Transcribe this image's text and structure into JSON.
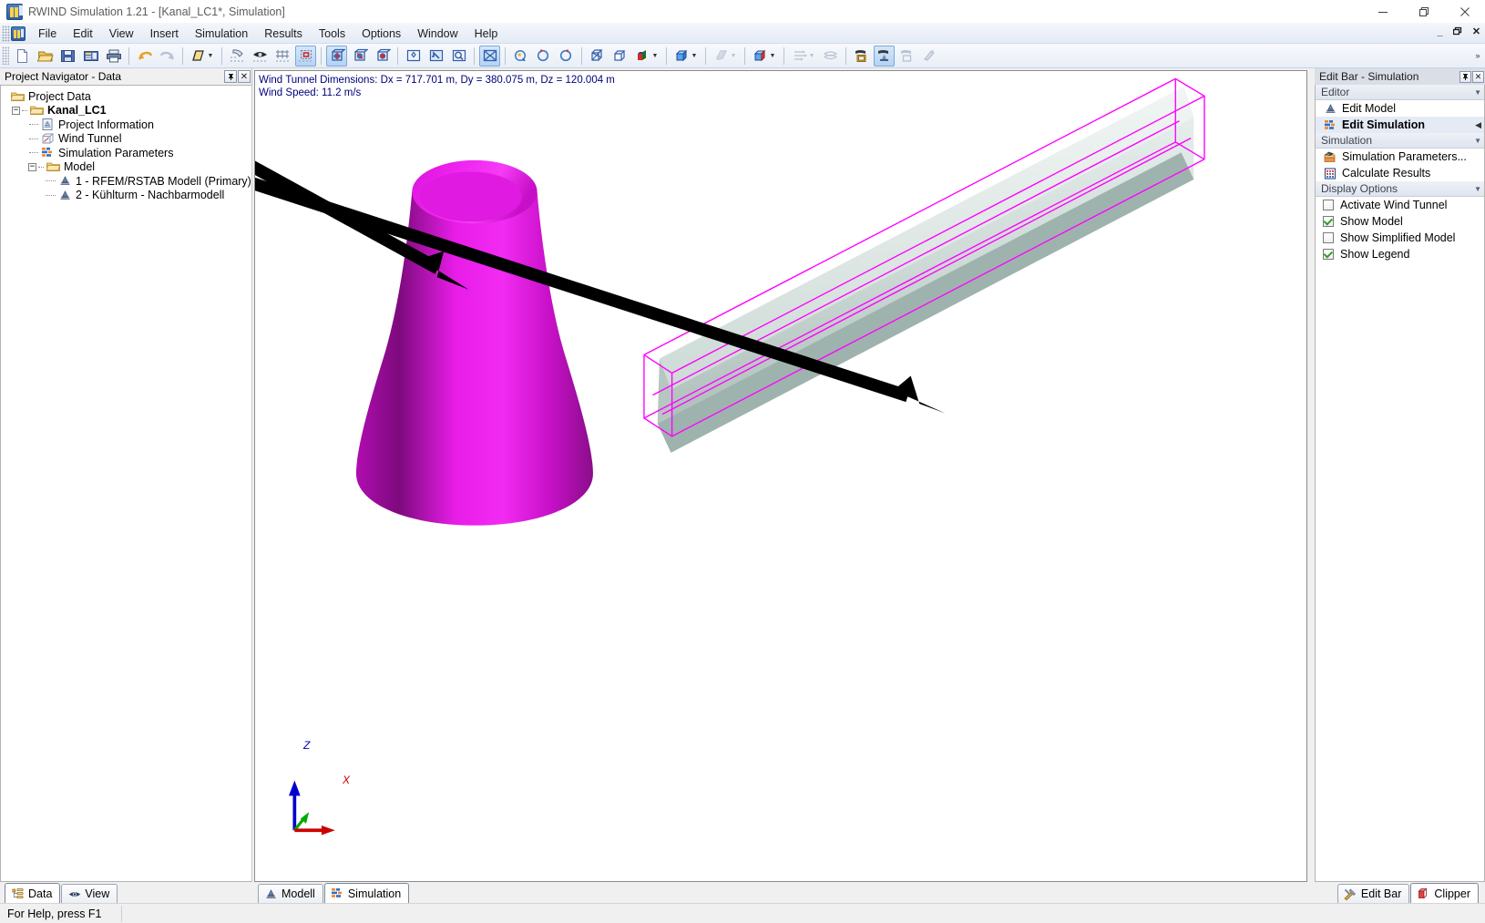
{
  "window": {
    "title": "RWIND Simulation 1.21 - [Kanal_LC1*, Simulation]",
    "app_icon": "rwind-icon",
    "controls": {
      "minimize": "minimize-icon",
      "restore": "restore-icon",
      "close": "close-icon"
    }
  },
  "mdi_controls": {
    "minimize": "_",
    "restore": "□",
    "close": "✕"
  },
  "menu": {
    "items": [
      {
        "label": "File"
      },
      {
        "label": "Edit"
      },
      {
        "label": "View"
      },
      {
        "label": "Insert"
      },
      {
        "label": "Simulation"
      },
      {
        "label": "Results"
      },
      {
        "label": "Tools"
      },
      {
        "label": "Options"
      },
      {
        "label": "Window"
      },
      {
        "label": "Help"
      }
    ]
  },
  "toolbar": {
    "groups": [
      {
        "buttons": [
          {
            "name": "new-file-button",
            "icon": "new-document-icon"
          },
          {
            "name": "open-file-button",
            "icon": "open-folder-icon"
          },
          {
            "name": "save-button",
            "icon": "floppy-disk-icon"
          },
          {
            "name": "print-preview-button",
            "icon": "print-preview-icon"
          },
          {
            "name": "print-button",
            "icon": "printer-icon"
          }
        ]
      },
      {
        "buttons": [
          {
            "name": "undo-button",
            "icon": "undo-arrow-icon"
          },
          {
            "name": "redo-button",
            "icon": "redo-arrow-icon"
          }
        ]
      },
      {
        "buttons": [
          {
            "name": "render-mode-button",
            "icon": "render-mode-icon",
            "has_dropdown": true
          }
        ]
      },
      {
        "buttons": [
          {
            "name": "snap-button",
            "icon": "snap-grid-icon"
          },
          {
            "name": "object-snap-button",
            "icon": "object-snap-icon"
          },
          {
            "name": "grid-button",
            "icon": "grid-crosshair-icon"
          },
          {
            "name": "selection-box-button",
            "icon": "selection-box-icon",
            "active": true
          }
        ]
      },
      {
        "buttons": [
          {
            "name": "view-xy-button",
            "icon": "view-cube-xy-icon",
            "active": true
          },
          {
            "name": "view-xz-button",
            "icon": "view-cube-xz-icon"
          },
          {
            "name": "view-yz-button",
            "icon": "view-cube-yz-icon"
          }
        ]
      },
      {
        "buttons": [
          {
            "name": "zoom-extents-button",
            "icon": "zoom-extents-icon"
          },
          {
            "name": "zoom-previous-button",
            "icon": "zoom-previous-icon"
          },
          {
            "name": "zoom-window-button",
            "icon": "magnifier-icon"
          }
        ]
      },
      {
        "buttons": [
          {
            "name": "fit-all-button",
            "icon": "fit-all-icon",
            "active": true
          }
        ]
      },
      {
        "buttons": [
          {
            "name": "rotate-left-button",
            "icon": "rotate-left-icon"
          },
          {
            "name": "rotate-ccw-button",
            "icon": "rotate-ccw-icon"
          },
          {
            "name": "rotate-cw-button",
            "icon": "rotate-cw-icon"
          }
        ]
      },
      {
        "buttons": [
          {
            "name": "wireframe-view-button",
            "icon": "wireframe-cube-icon"
          },
          {
            "name": "perspective-button",
            "icon": "perspective-cube-icon"
          },
          {
            "name": "axis-display-button",
            "icon": "rgb-axis-icon",
            "has_dropdown": true
          }
        ]
      },
      {
        "buttons": [
          {
            "name": "solid-render-button",
            "icon": "blue-cube-icon",
            "has_dropdown": true
          }
        ]
      },
      {
        "buttons": [
          {
            "name": "section-plane-button",
            "icon": "hatched-plane-icon",
            "has_dropdown": true,
            "disabled": true
          }
        ]
      },
      {
        "buttons": [
          {
            "name": "clipper-cube-button",
            "icon": "red-cube-icon",
            "has_dropdown": true
          }
        ]
      },
      {
        "buttons": [
          {
            "name": "flow-lines-button",
            "icon": "flow-arrows-icon",
            "has_dropdown": true,
            "disabled": true
          },
          {
            "name": "iso-surfaces-button",
            "icon": "iso-surface-icon",
            "disabled": true
          }
        ]
      },
      {
        "buttons": [
          {
            "name": "show-terrain-button",
            "icon": "terrain-icon"
          },
          {
            "name": "show-model-button",
            "icon": "show-model-icon",
            "active": true
          },
          {
            "name": "show-simplified-button",
            "icon": "simplified-model-icon",
            "disabled": true
          },
          {
            "name": "show-legend-button",
            "icon": "legend-icon",
            "disabled": true
          }
        ]
      }
    ],
    "overflow_label": "»"
  },
  "navigator": {
    "title": "Project Navigator - Data",
    "pin_button": "↯",
    "close_button": "✕",
    "tree": [
      {
        "level": 0,
        "label": "Project Data",
        "icon": "folder-icon",
        "bold": false,
        "expander": null,
        "name": "tree-item-project-data"
      },
      {
        "level": 1,
        "label": "Kanal_LC1",
        "icon": "folder-icon",
        "bold": true,
        "expander": "-",
        "name": "tree-item-kanal-lc1"
      },
      {
        "level": 2,
        "label": "Project Information",
        "icon": "project-information-icon",
        "bold": false,
        "expander": null,
        "name": "tree-item-project-information"
      },
      {
        "level": 2,
        "label": "Wind Tunnel",
        "icon": "wind-tunnel-icon",
        "bold": false,
        "expander": null,
        "name": "tree-item-wind-tunnel"
      },
      {
        "level": 2,
        "label": "Simulation Parameters",
        "icon": "simulation-parameters-icon",
        "bold": false,
        "expander": null,
        "name": "tree-item-simulation-parameters"
      },
      {
        "level": 2,
        "label": "Model",
        "icon": "folder-icon",
        "bold": false,
        "expander": "-",
        "name": "tree-item-model"
      },
      {
        "level": 3,
        "label": "1 - RFEM/RSTAB Modell (Primary)",
        "icon": "model-object-icon",
        "bold": false,
        "expander": null,
        "name": "tree-item-rfem-rstab-modell"
      },
      {
        "level": 3,
        "label": "2 - Kühlturm - Nachbarmodell",
        "icon": "model-object-icon",
        "bold": false,
        "expander": null,
        "name": "tree-item-kuehlturm-nachbarmodell"
      }
    ]
  },
  "viewport": {
    "legend_line1": "Wind Tunnel Dimensions: Dx = 717.701 m, Dy = 380.075 m, Dz = 120.004 m",
    "legend_line2": "Wind Speed: 11.2 m/s",
    "legend_color": "#00007a",
    "axis_indicator": {
      "z_label": "Z",
      "x_label": "X",
      "z_color": "#0000cc",
      "x_color": "#cc0000",
      "y_color": "#00aa00"
    },
    "model_colors": {
      "tower_magenta_light": "#ee22ee",
      "tower_magenta_dark": "#8c0f8c",
      "duct_gray": "#c3d0cc",
      "wind_tunnel_outline": "#ff00ff"
    },
    "annotations": [
      {
        "name": "annotation-arrow-to-tower",
        "target": "cooling-tower"
      },
      {
        "name": "annotation-arrow-to-duct",
        "target": "duct"
      }
    ]
  },
  "editbar": {
    "title": "Edit Bar - Simulation",
    "pin_button": "↯",
    "close_button": "✕",
    "sections": [
      {
        "title": "Editor",
        "chevron": "▼",
        "items": [
          {
            "label": "Edit Model",
            "icon": "edit-model-icon",
            "bold": false,
            "selected": false,
            "name": "editbar-item-edit-model"
          },
          {
            "label": "Edit Simulation",
            "icon": "edit-simulation-icon",
            "bold": true,
            "selected": true,
            "arrow": "◀",
            "name": "editbar-item-edit-simulation"
          }
        ]
      },
      {
        "title": "Simulation",
        "chevron": "▼",
        "items": [
          {
            "label": "Simulation Parameters...",
            "icon": "simulation-parameters-icon",
            "bold": false,
            "selected": false,
            "name": "editbar-item-simulation-parameters"
          },
          {
            "label": "Calculate Results",
            "icon": "calculate-results-icon",
            "bold": false,
            "selected": false,
            "name": "editbar-item-calculate-results"
          }
        ]
      },
      {
        "title": "Display Options",
        "chevron": "▼",
        "checkboxes": [
          {
            "label": "Activate Wind Tunnel",
            "checked": false,
            "name": "checkbox-activate-wind-tunnel"
          },
          {
            "label": "Show Model",
            "checked": true,
            "name": "checkbox-show-model"
          },
          {
            "label": "Show Simplified Model",
            "checked": false,
            "name": "checkbox-show-simplified-model"
          },
          {
            "label": "Show Legend",
            "checked": true,
            "name": "checkbox-show-legend"
          }
        ]
      }
    ]
  },
  "tabs": {
    "left": [
      {
        "label": "Data",
        "icon": "data-tree-icon",
        "active": true,
        "name": "tab-data"
      },
      {
        "label": "View",
        "icon": "eye-icon",
        "active": false,
        "name": "tab-view"
      }
    ],
    "center": [
      {
        "label": "Modell",
        "icon": "model-object-icon",
        "active": false,
        "name": "tab-modell"
      },
      {
        "label": "Simulation",
        "icon": "simulation-parameters-icon",
        "active": true,
        "name": "tab-simulation"
      }
    ],
    "right": [
      {
        "label": "Edit Bar",
        "icon": "hammer-wrench-icon",
        "active": false,
        "name": "tab-edit-bar"
      },
      {
        "label": "Clipper",
        "icon": "clipper-cube-icon",
        "active": true,
        "name": "tab-clipper"
      }
    ]
  },
  "statusbar": {
    "help_text": "For Help, press F1"
  }
}
